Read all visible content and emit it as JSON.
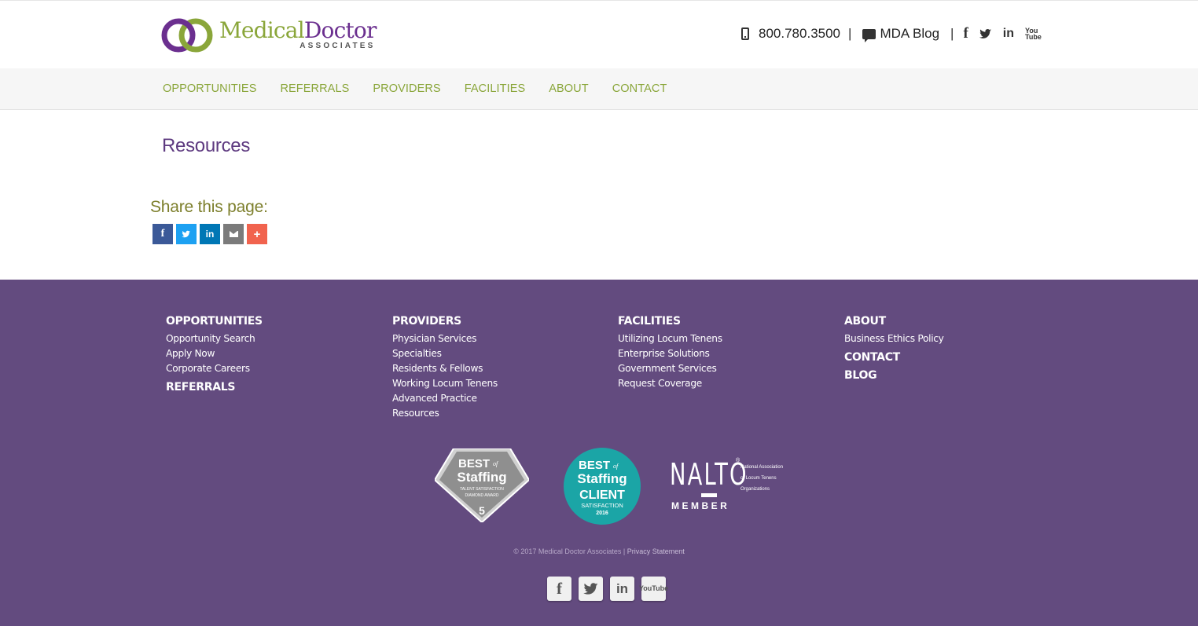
{
  "header": {
    "logo": {
      "word_medical": "Medical",
      "word_doctor": "Doctor",
      "subtitle": "ASSOCIATES"
    },
    "phone": "800.780.3500",
    "separator": "|",
    "blog_label": "MDA Blog",
    "social_icons": [
      "facebook-icon",
      "twitter-icon",
      "linkedin-icon",
      "youtube-icon"
    ]
  },
  "nav": {
    "items": [
      "OPPORTUNITIES",
      "REFERRALS",
      "PROVIDERS",
      "FACILITIES",
      "ABOUT",
      "CONTACT"
    ]
  },
  "main": {
    "title": "Resources",
    "share_title": "Share this page:"
  },
  "footer": {
    "col1": {
      "head": "OPPORTUNITIES",
      "links": [
        "Opportunity Search",
        "Apply Now",
        "Corporate Careers"
      ],
      "head2": "REFERRALS"
    },
    "col2": {
      "head": "PROVIDERS",
      "links": [
        "Physician Services",
        "Specialties",
        "Residents & Fellows",
        "Working Locum Tenens",
        "Advanced Practice",
        "Resources"
      ]
    },
    "col3": {
      "head": "FACILITIES",
      "links": [
        "Utilizing Locum Tenens",
        "Enterprise Solutions",
        "Government Services",
        "Request Coverage"
      ]
    },
    "col4": {
      "head": "ABOUT",
      "links": [
        "Business Ethics Policy"
      ],
      "head2": "CONTACT",
      "head3": "BLOG"
    },
    "badge1": {
      "l1": "BEST",
      "l2": "of",
      "l3": "Staffing",
      "l4": "TALENT SATISFACTION",
      "l5": "DIAMOND AWARD",
      "l6": "5"
    },
    "badge2": {
      "l1": "BEST",
      "l2": "of",
      "l3": "Staffing",
      "l4": "CLIENT",
      "l5": "SATISFACTION",
      "l6": "2016"
    },
    "nalto": {
      "word": "NALTO",
      "reg": "®",
      "desc1": "National Association",
      "desc2": "of Locum Tenens",
      "desc3": "Organizations",
      "member": "MEMBER"
    },
    "copyright": "© 2017 Medical Doctor Associates",
    "copyright_sep": " | ",
    "privacy": "Privacy Statement",
    "yt_top": "You",
    "yt_bottom": "Tube"
  },
  "colors": {
    "brand_green": "#8aa63a",
    "brand_purple": "#6b2f8f",
    "footer_bg": "#634b7f",
    "share_facebook": "#3b5998",
    "share_twitter": "#1da1f2",
    "share_linkedin": "#0077b5",
    "share_email": "#7b7b7b",
    "share_more": "#f1634e"
  }
}
